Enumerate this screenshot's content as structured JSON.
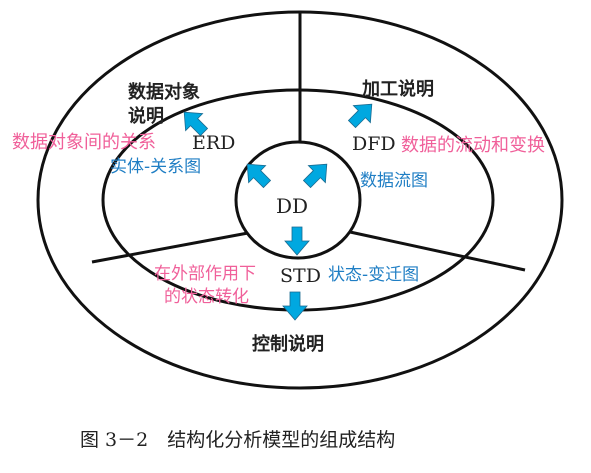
{
  "diagram": {
    "center": "DD",
    "sections": {
      "erd": {
        "code": "ERD",
        "outer_label": [
          "数据对象",
          "说明"
        ],
        "annotation": "数据对象间的关系",
        "name": "实体-关系图"
      },
      "dfd": {
        "code": "DFD",
        "outer_label": "加工说明",
        "annotation": "数据的流动和变换",
        "name": "数据流图"
      },
      "std": {
        "code": "STD",
        "outer_label": "控制说明",
        "annotation": [
          "在外部作用下",
          "的状态转化"
        ],
        "name": "状态-变迁图"
      }
    },
    "caption": "图 3－2　结构化分析模型的组成结构"
  },
  "colors": {
    "arrow": "#00a8e0",
    "annotation": "#f0609a",
    "name": "#1f7ec4",
    "line": "#111111"
  }
}
